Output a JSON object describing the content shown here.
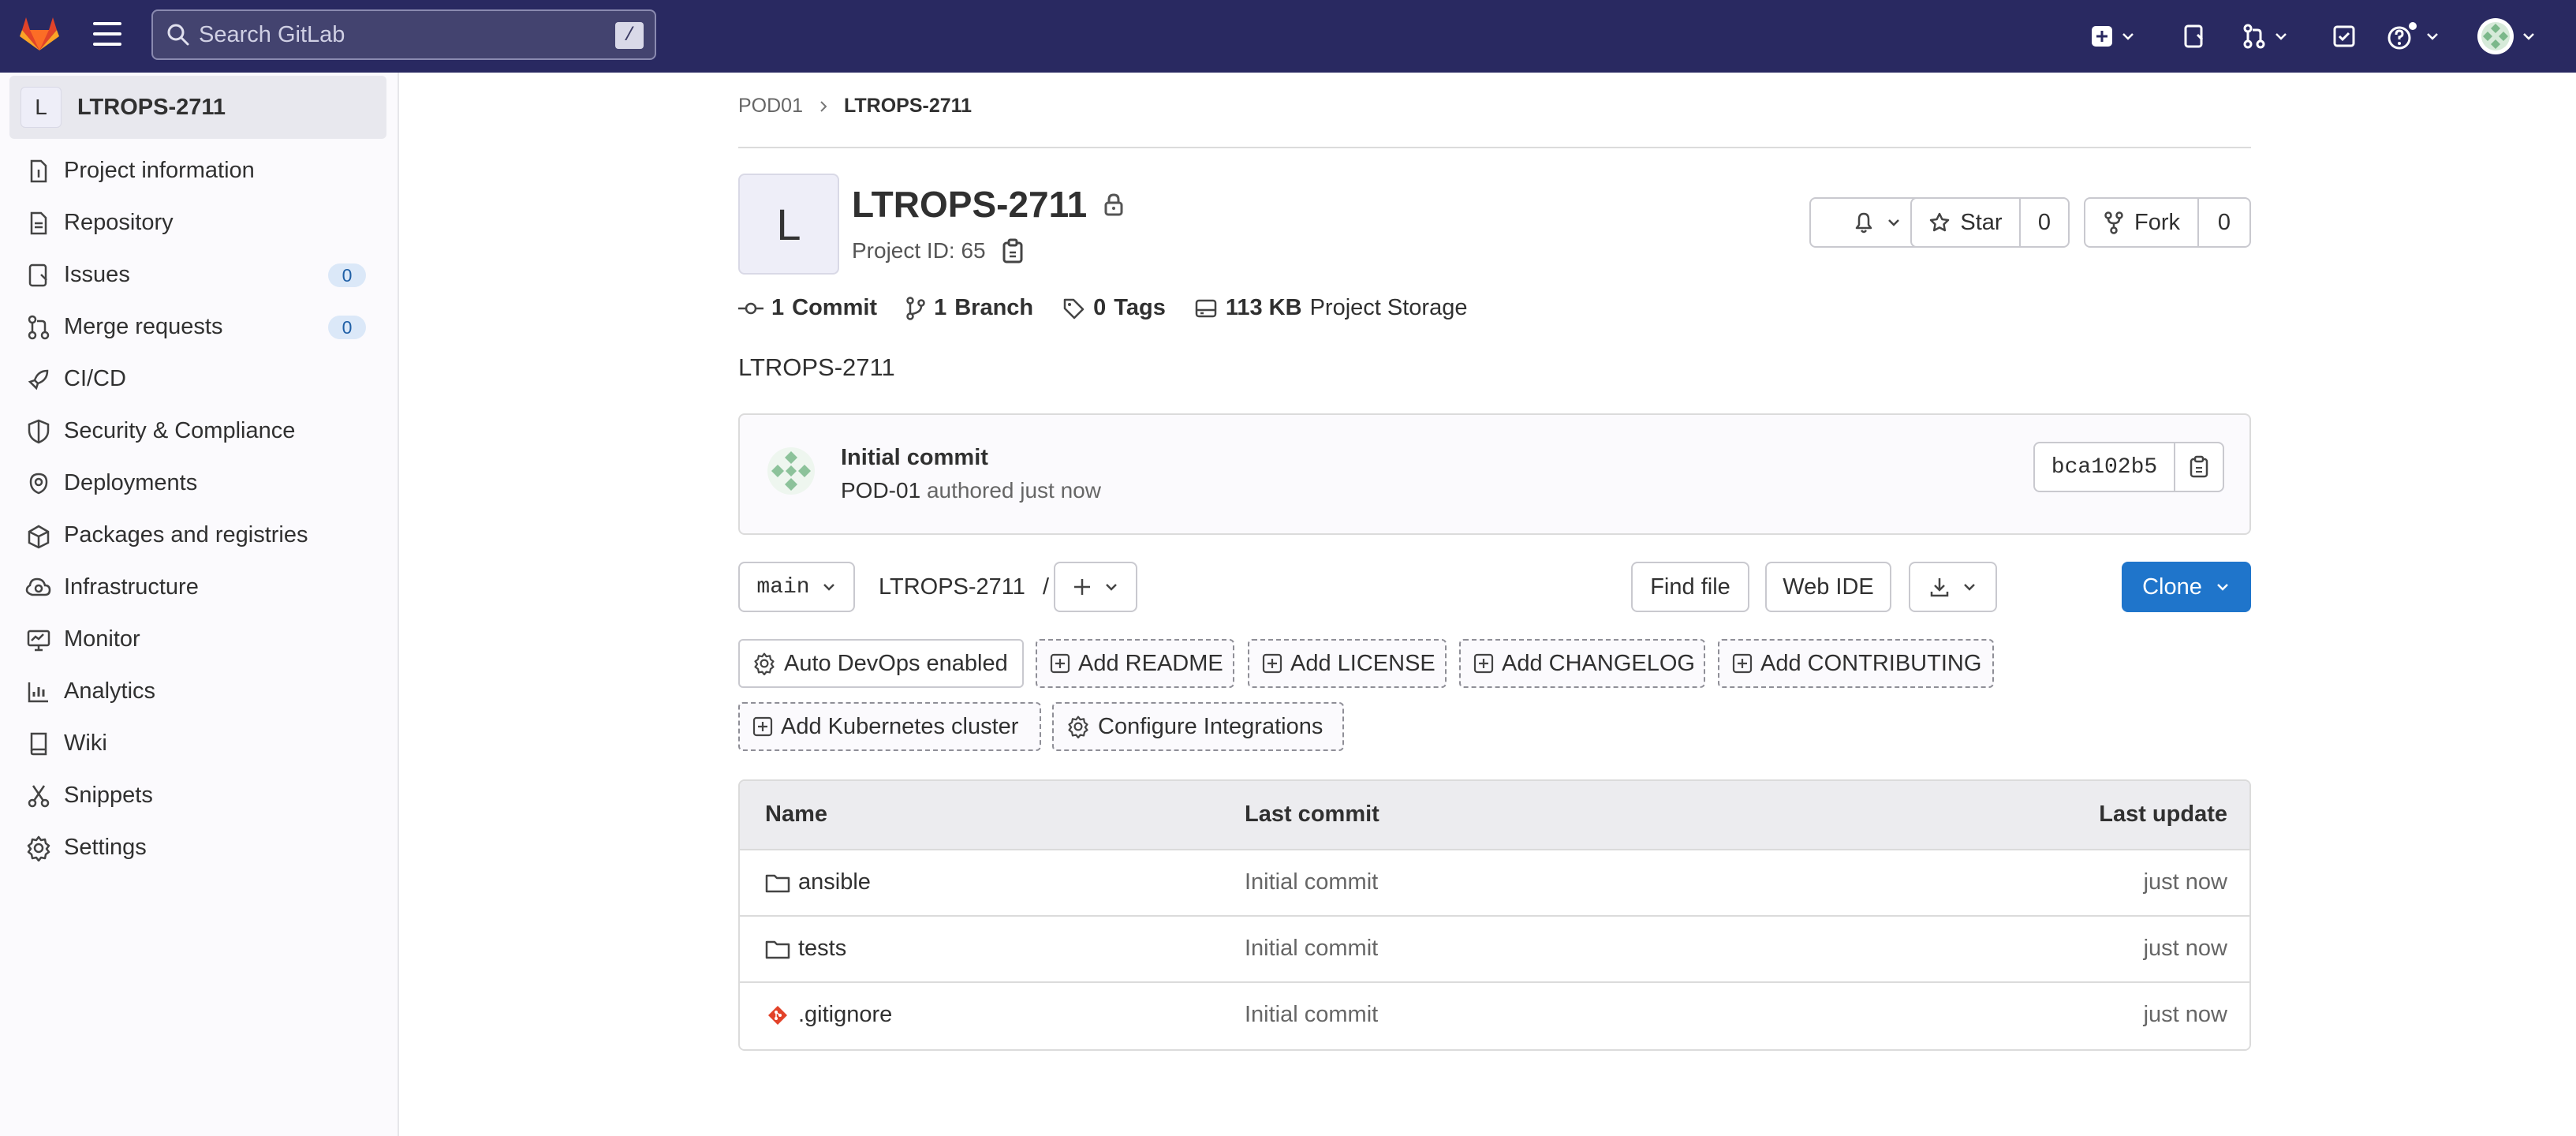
{
  "search": {
    "placeholder": "Search GitLab",
    "shortcut": "/"
  },
  "sidebar": {
    "project_initial": "L",
    "project_name": "LTROPS-2711",
    "items": [
      {
        "label": "Project information",
        "icon": "info-doc-icon"
      },
      {
        "label": "Repository",
        "icon": "doc-icon"
      },
      {
        "label": "Issues",
        "icon": "issues-icon",
        "badge": "0"
      },
      {
        "label": "Merge requests",
        "icon": "merge-request-icon",
        "badge": "0"
      },
      {
        "label": "CI/CD",
        "icon": "rocket-icon"
      },
      {
        "label": "Security & Compliance",
        "icon": "shield-icon"
      },
      {
        "label": "Deployments",
        "icon": "deployments-icon"
      },
      {
        "label": "Packages and registries",
        "icon": "package-icon"
      },
      {
        "label": "Infrastructure",
        "icon": "cloud-gear-icon"
      },
      {
        "label": "Monitor",
        "icon": "monitor-icon"
      },
      {
        "label": "Analytics",
        "icon": "chart-icon"
      },
      {
        "label": "Wiki",
        "icon": "book-icon"
      },
      {
        "label": "Snippets",
        "icon": "scissors-icon"
      },
      {
        "label": "Settings",
        "icon": "gear-icon"
      }
    ]
  },
  "breadcrumb": {
    "parent": "POD01",
    "current": "LTROPS-2711"
  },
  "project": {
    "initial": "L",
    "title": "LTROPS-2711",
    "id_label": "Project ID: 65",
    "description": "LTROPS-2711"
  },
  "actions": {
    "star_label": "Star",
    "star_count": "0",
    "fork_label": "Fork",
    "fork_count": "0"
  },
  "stats": [
    {
      "value": "1",
      "label": "Commit"
    },
    {
      "value": "1",
      "label": "Branch"
    },
    {
      "value": "0",
      "label": "Tags"
    },
    {
      "value": "113 KB",
      "label": "Project Storage"
    }
  ],
  "commit": {
    "title": "Initial commit",
    "author": "POD-01",
    "meta": "authored just now",
    "sha": "bca102b5"
  },
  "toolbar": {
    "branch": "main",
    "path": "LTROPS-2711",
    "path_sep": "/",
    "find_file": "Find file",
    "web_ide": "Web IDE",
    "clone": "Clone"
  },
  "quick_actions": [
    "Auto DevOps enabled",
    "Add README",
    "Add LICENSE",
    "Add CHANGELOG",
    "Add CONTRIBUTING",
    "Add Kubernetes cluster",
    "Configure Integrations"
  ],
  "table": {
    "headers": {
      "name": "Name",
      "last_commit": "Last commit",
      "last_update": "Last update"
    },
    "rows": [
      {
        "name": "ansible",
        "type": "folder",
        "commit": "Initial commit",
        "updated": "just now"
      },
      {
        "name": "tests",
        "type": "folder",
        "commit": "Initial commit",
        "updated": "just now"
      },
      {
        "name": ".gitignore",
        "type": "git-file",
        "commit": "Initial commit",
        "updated": "just now"
      }
    ]
  },
  "colors": {
    "navbar": "#292961",
    "primary": "#1f75cb",
    "badge_bg": "#dbe8f8"
  }
}
